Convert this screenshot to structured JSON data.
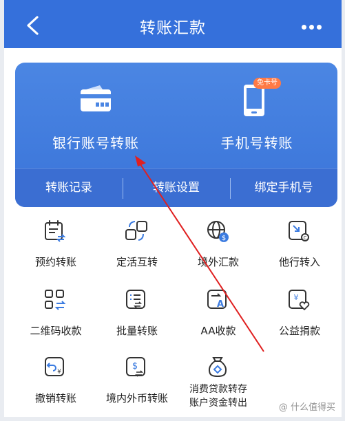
{
  "header": {
    "title": "转账汇款"
  },
  "card": {
    "bank_transfer": "银行账号转账",
    "phone_transfer": "手机号转账",
    "badge": "免卡号",
    "bottom": [
      "转账记录",
      "转账设置",
      "绑定手机号"
    ]
  },
  "grid": [
    {
      "label": "预约转账",
      "icon": "calendar-transfer-icon"
    },
    {
      "label": "定活互转",
      "icon": "fixed-current-swap-icon"
    },
    {
      "label": "境外汇款",
      "icon": "globe-dollar-icon"
    },
    {
      "label": "他行转入",
      "icon": "incoming-transfer-icon"
    },
    {
      "label": "二维码收款",
      "icon": "qr-code-icon"
    },
    {
      "label": "批量转账",
      "icon": "batch-list-icon"
    },
    {
      "label": "AA收款",
      "icon": "aa-collect-icon"
    },
    {
      "label": "公益捐款",
      "icon": "charity-heart-icon"
    },
    {
      "label": "撤销转账",
      "icon": "undo-yen-icon"
    },
    {
      "label": "境内外币转账",
      "icon": "foreign-currency-icon"
    },
    {
      "label": "消费贷款转存\n账户资金转出",
      "icon": "money-bag-icon"
    }
  ],
  "watermark": "@ 什么值得买",
  "colors": {
    "primary": "#3570db",
    "card": "#4080e0",
    "icon_stroke": "#333333",
    "accent": "#3b7be0",
    "arrow": "#e02020"
  }
}
